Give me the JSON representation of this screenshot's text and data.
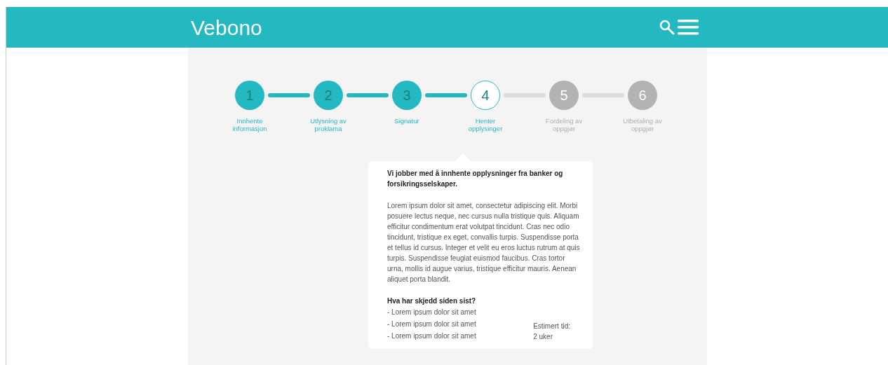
{
  "header": {
    "logo": "Vebono"
  },
  "steps": [
    {
      "number": "1",
      "label": "Innhente informasjon",
      "done": true,
      "selected": false
    },
    {
      "number": "2",
      "label": "Utlysning av proklama",
      "done": true,
      "selected": false
    },
    {
      "number": "3",
      "label": "Signatur",
      "done": true,
      "selected": false
    },
    {
      "number": "4",
      "label": "Henter opplysinger",
      "done": false,
      "selected": true
    },
    {
      "number": "5",
      "label": "Fordeling av oppgjør",
      "done": false,
      "selected": false
    },
    {
      "number": "6",
      "label": "Utbetaling av oppgjør",
      "done": false,
      "selected": false
    }
  ],
  "card": {
    "title": "Vi jobber med å innhente opplysninger fra banker og forsikringsselskaper.",
    "body": "Lorem ipsum dolor sit amet, consectetur adipiscing elit. Morbi posuere lectus neque, nec cursus nulla tristique quis. Aliquam efficitur condimentum erat volutpat tincidunt. Cras nec odio tincidunt, tristique ex eget, convallis turpis. Suspendisse porta et tellus id cursus. Integer et velit eu eros luctus rutrum at quis turpis. Suspendisse feugiat euismod faucibus. Cras tortor urna, mollis id augue varius, tristique efficitur mauris. Aenean aliquet porta blandit.",
    "updates_heading": "Hva har skjedd siden sist?",
    "updates": [
      "- Lorem ipsum dolor sit amet",
      "- Lorem ipsum dolor sit amet",
      "- Lorem ipsum dolor sit amet"
    ],
    "estimate_label": "Estimert tid:",
    "estimate_value": "2 uker"
  }
}
